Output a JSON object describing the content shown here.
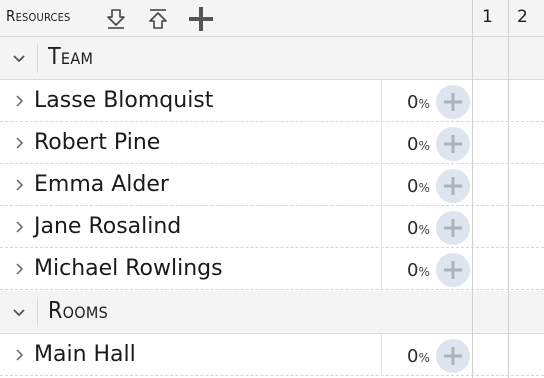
{
  "header": {
    "title": "Resources",
    "icons": [
      "expand-all-icon",
      "collapse-all-icon",
      "add-icon"
    ],
    "days": [
      "1",
      "2"
    ]
  },
  "groups": [
    {
      "name": "Team",
      "expanded": true,
      "items": [
        {
          "name": "Lasse Blomquist",
          "percent": "0",
          "unit": "%"
        },
        {
          "name": "Robert Pine",
          "percent": "0",
          "unit": "%"
        },
        {
          "name": "Emma Alder",
          "percent": "0",
          "unit": "%"
        },
        {
          "name": "Jane Rosalind",
          "percent": "0",
          "unit": "%"
        },
        {
          "name": "Michael Rowlings",
          "percent": "0",
          "unit": "%"
        }
      ]
    },
    {
      "name": "Rooms",
      "expanded": true,
      "items": [
        {
          "name": "Main Hall",
          "percent": "0",
          "unit": "%"
        }
      ]
    }
  ],
  "colors": {
    "header_bg": "#f4f4f4",
    "add_circle": "#dfe5ee",
    "add_plus": "#a9b2be"
  }
}
